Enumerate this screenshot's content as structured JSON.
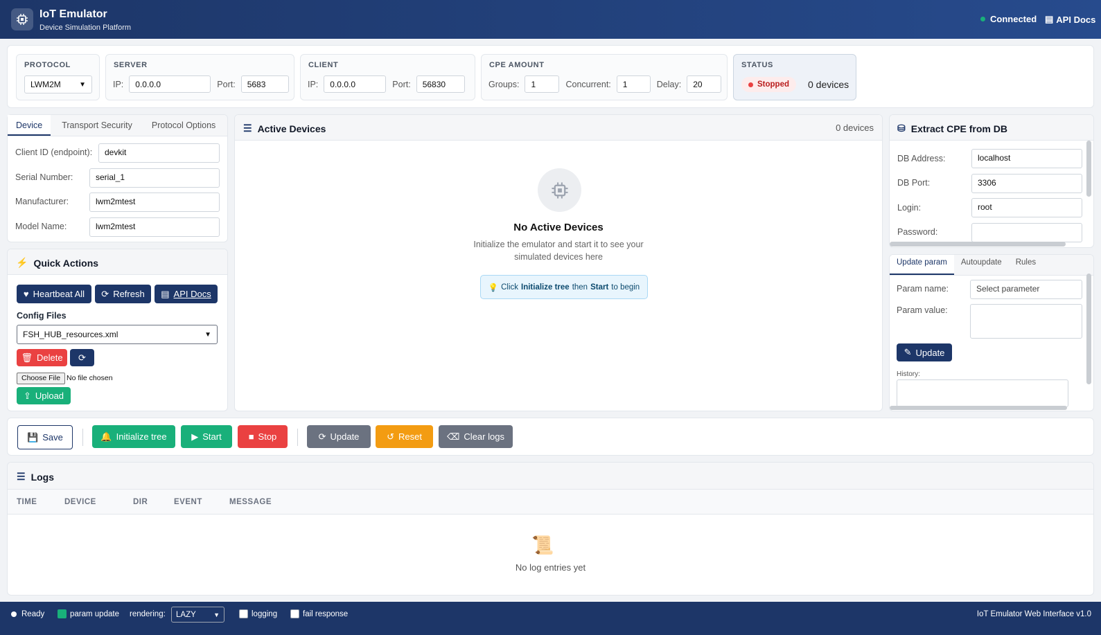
{
  "header": {
    "title": "IoT Emulator",
    "subtitle": "Device Simulation Platform",
    "status": "Connected",
    "api_docs": "API Docs"
  },
  "config": {
    "protocol": {
      "label": "PROTOCOL",
      "value": "LWM2M"
    },
    "server": {
      "label": "SERVER",
      "ip_label": "IP:",
      "ip": "0.0.0.0",
      "port_label": "Port:",
      "port": "5683"
    },
    "client": {
      "label": "CLIENT",
      "ip_label": "IP:",
      "ip": "0.0.0.0",
      "port_label": "Port:",
      "port": "56830"
    },
    "cpe": {
      "label": "CPE AMOUNT",
      "groups_label": "Groups:",
      "groups": "1",
      "concurrent_label": "Concurrent:",
      "concurrent": "1",
      "delay_label": "Delay:",
      "delay": "20"
    },
    "status": {
      "label": "STATUS",
      "badge": "Stopped",
      "devices": "0 devices"
    }
  },
  "device_tabs": [
    "Device",
    "Transport Security",
    "Protocol Options"
  ],
  "device": {
    "client_id_label": "Client ID (endpoint):",
    "client_id": "devkit",
    "serial_label": "Serial Number:",
    "serial": "serial_1",
    "manufacturer_label": "Manufacturer:",
    "manufacturer": "lwm2mtest",
    "model_label": "Model Name:",
    "model": "lwm2mtest"
  },
  "quick_actions": {
    "title": "Quick Actions",
    "heartbeat": "Heartbeat All",
    "refresh": "Refresh",
    "api_docs": "API Docs",
    "config_files_label": "Config Files",
    "config_file": "FSH_HUB_resources.xml",
    "delete": "Delete",
    "choose_file": "Choose File",
    "no_file": "No file chosen",
    "upload": "Upload"
  },
  "active_devices": {
    "title": "Active Devices",
    "count": "0 devices",
    "empty_title": "No Active Devices",
    "empty_line1": "Initialize the emulator and start it to see your",
    "empty_line2": "simulated devices here",
    "hint_pre": "Click",
    "hint_init": "Initialize tree",
    "hint_mid": "then",
    "hint_start": "Start",
    "hint_post": "to begin"
  },
  "extract": {
    "title": "Extract CPE from DB",
    "db_address_label": "DB Address:",
    "db_address": "localhost",
    "db_port_label": "DB Port:",
    "db_port": "3306",
    "login_label": "Login:",
    "login": "root",
    "password_label": "Password:",
    "password": ""
  },
  "param_tabs": [
    "Update param",
    "Autoupdate",
    "Rules"
  ],
  "param": {
    "name_label": "Param name:",
    "name_placeholder": "Select parameter",
    "value_label": "Param value:",
    "update": "Update",
    "history_label": "History:"
  },
  "toolbar": {
    "save": "Save",
    "init": "Initialize tree",
    "start": "Start",
    "stop": "Stop",
    "update": "Update",
    "reset": "Reset",
    "clear": "Clear logs"
  },
  "logs": {
    "title": "Logs",
    "columns": [
      "TIME",
      "DEVICE",
      "DIR",
      "EVENT",
      "MESSAGE"
    ],
    "empty": "No log entries yet"
  },
  "footer": {
    "ready": "Ready",
    "param_update": "param update",
    "rendering_label": "rendering:",
    "rendering": "LAZY",
    "logging": "logging",
    "fail_response": "fail response",
    "version": "IoT Emulator Web Interface v1.0"
  },
  "colors": {
    "navy": "#1d3668",
    "green": "#19b07a",
    "red": "#ea4141",
    "orange": "#f39c12",
    "gray": "#6b7280"
  }
}
